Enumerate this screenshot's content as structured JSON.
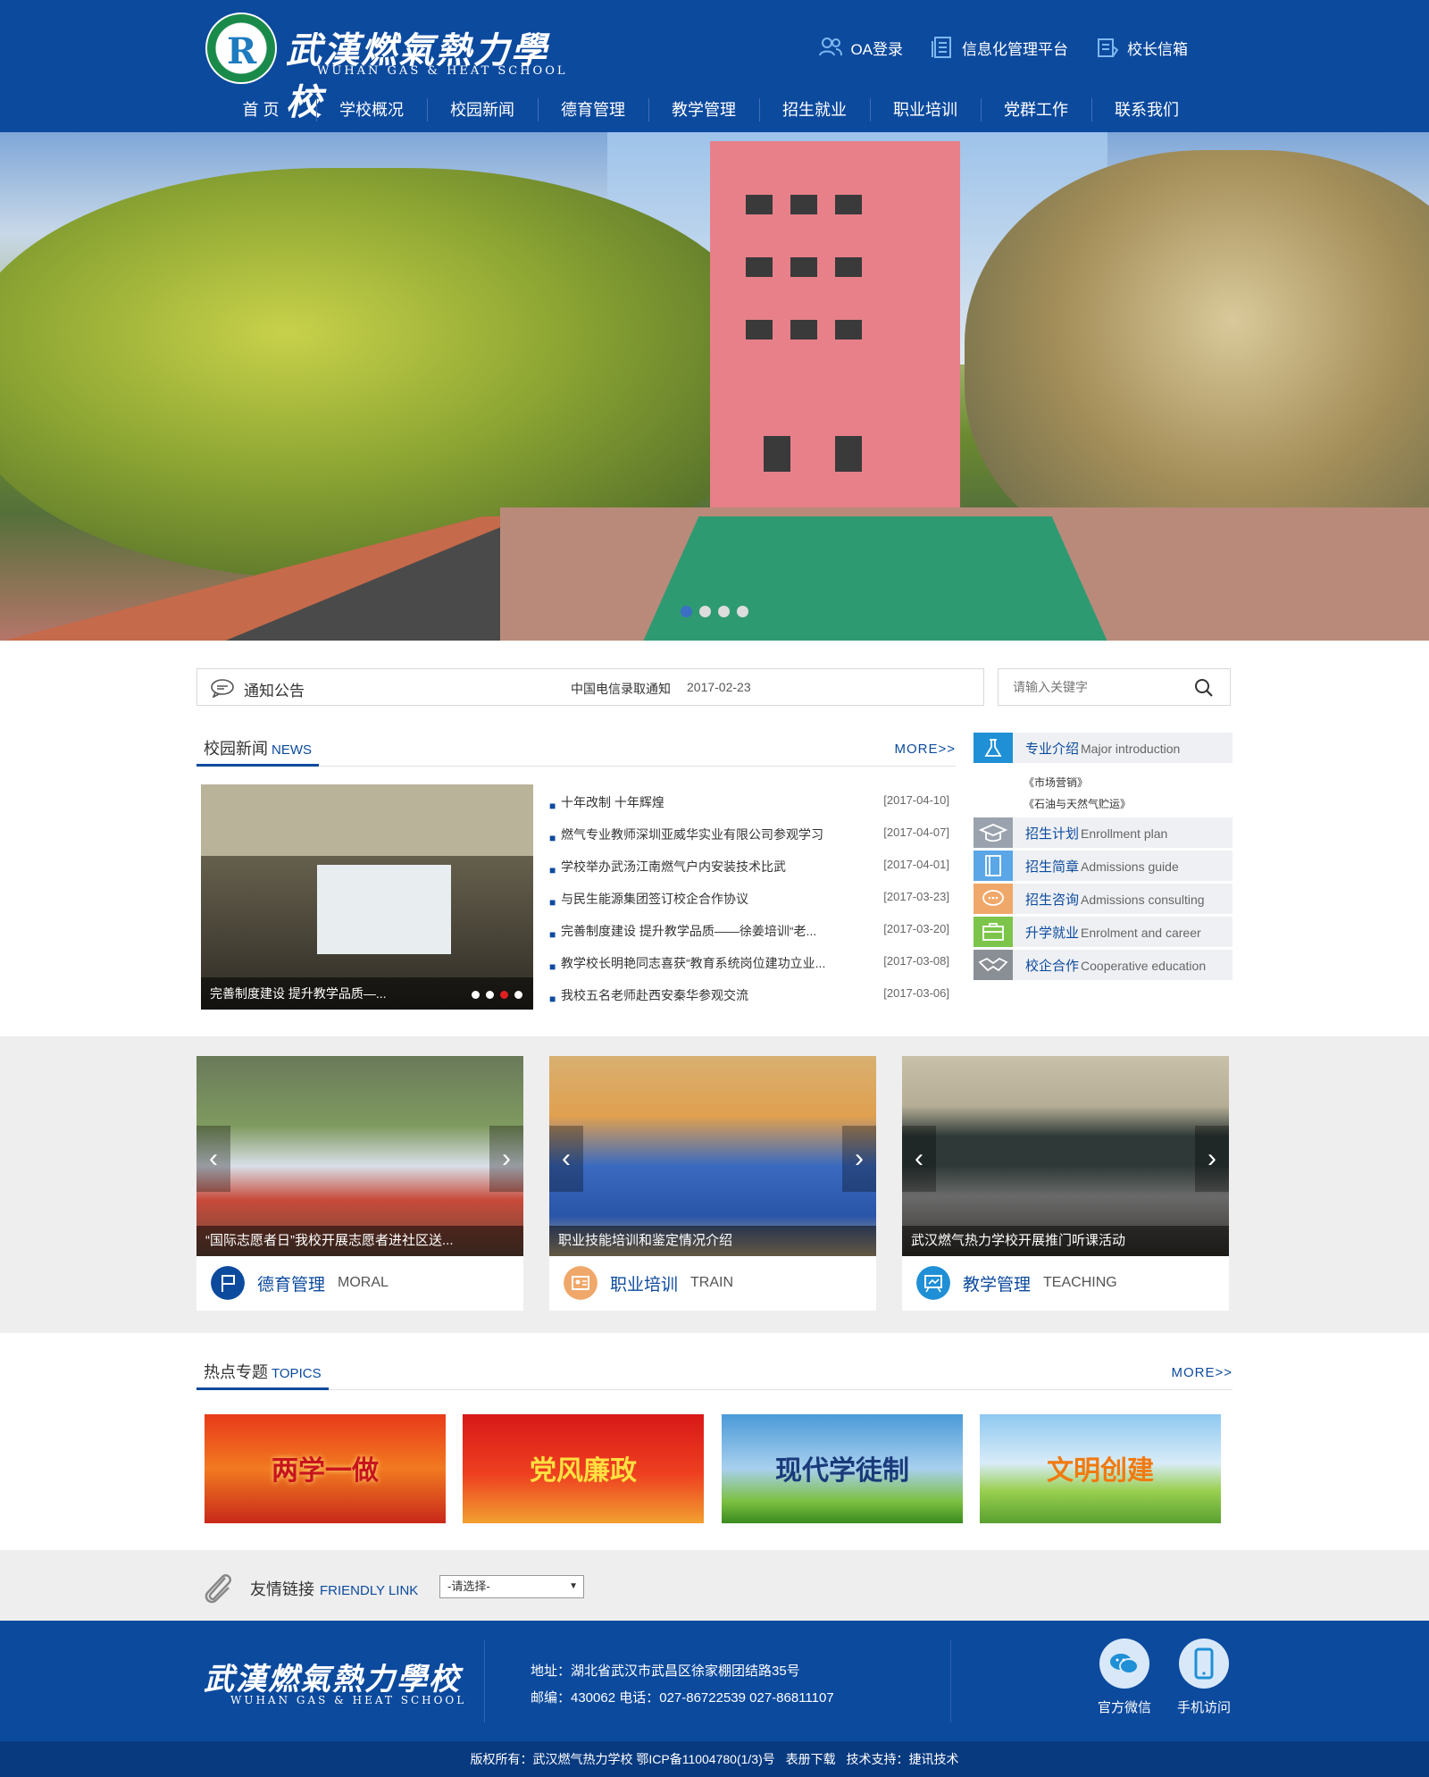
{
  "header": {
    "logo_cn": "武漢燃氣熱力學校",
    "logo_en": "WUHAN GAS & HEAT SCHOOL",
    "toplinks": [
      {
        "label": "OA登录",
        "icon": "users-icon"
      },
      {
        "label": "信息化管理平台",
        "icon": "document-icon"
      },
      {
        "label": "校长信箱",
        "icon": "mailbox-icon"
      }
    ],
    "nav": [
      "首 页",
      "学校概况",
      "校园新闻",
      "德育管理",
      "教学管理",
      "招生就业",
      "职业培训",
      "党群工作",
      "联系我们"
    ]
  },
  "banner": {
    "slides": 4,
    "active_slide": 1
  },
  "notice": {
    "title": "通知公告",
    "text": "中国电信录取通知",
    "date": "2017-02-23"
  },
  "search": {
    "placeholder": "请输入关键字"
  },
  "news": {
    "title_cn": "校园新闻",
    "title_en": "NEWS",
    "more": "MORE>>",
    "featured_caption": "完善制度建设 提升教学品质—...",
    "items": [
      {
        "title": "十年改制 十年辉煌",
        "date": "[2017-04-10]"
      },
      {
        "title": "燃气专业教师深圳亚威华实业有限公司参观学习",
        "date": "[2017-04-07]"
      },
      {
        "title": "学校举办武汤江南燃气户内安装技术比武",
        "date": "[2017-04-01]"
      },
      {
        "title": "与民生能源集团签订校企合作协议",
        "date": "[2017-03-23]"
      },
      {
        "title": "完善制度建设 提升教学品质——徐姜培训“老...",
        "date": "[2017-03-20]"
      },
      {
        "title": "教学校长明艳同志喜获“教育系统岗位建功立业...",
        "date": "[2017-03-08]"
      },
      {
        "title": "我校五名老师赴西安秦华参观交流",
        "date": "[2017-03-06]"
      }
    ]
  },
  "sidebar": {
    "major": {
      "cn": "专业介绍",
      "en": "Major introduction",
      "subs": [
        "《市场营销》",
        "《石油与天然气贮运》"
      ]
    },
    "items": [
      {
        "cn": "招生计划",
        "en": "Enrollment plan",
        "icon": "graduation-cap-icon",
        "color": "#9aa3ad"
      },
      {
        "cn": "招生简章",
        "en": "Admissions guide",
        "icon": "book-icon",
        "color": "#5aa6e6"
      },
      {
        "cn": "招生咨询",
        "en": "Admissions consulting",
        "icon": "chat-bubble-icon",
        "color": "#f0a86a"
      },
      {
        "cn": "升学就业",
        "en": "Enrolment and career",
        "icon": "briefcase-icon",
        "color": "#7cc54a"
      },
      {
        "cn": "校企合作",
        "en": "Cooperative education",
        "icon": "handshake-icon",
        "color": "#8a8f96"
      }
    ]
  },
  "cards": [
    {
      "caption": "“国际志愿者日”我校开展志愿者进社区送...",
      "cn": "德育管理",
      "en": "MORAL",
      "icon": "flag-icon",
      "color": "#0c4a9e"
    },
    {
      "caption": "职业技能培训和鉴定情况介绍",
      "cn": "职业培训",
      "en": "TRAIN",
      "icon": "person-card-icon",
      "color": "#f0a86a"
    },
    {
      "caption": "武汉燃气热力学校开展推门听课活动",
      "cn": "教学管理",
      "en": "TEACHING",
      "icon": "whiteboard-icon",
      "color": "#1f8fd6"
    }
  ],
  "topics": {
    "title_cn": "热点专题",
    "title_en": "TOPICS",
    "more": "MORE>>",
    "items": [
      "两学一做",
      "党风廉政",
      "现代学徒制",
      "文明创建"
    ]
  },
  "friendly_link": {
    "title_cn": "友情链接",
    "title_en": "FRIENDLY LINK",
    "select_value": "-请选择-"
  },
  "footer": {
    "logo_cn": "武漢燃氣熱力學校",
    "logo_en": "WUHAN GAS & HEAT SCHOOL",
    "address": "地址：湖北省武汉市武昌区徐家棚团结路35号",
    "contact": "邮编：430062  电话：027-86722539  027-86811107",
    "wechat_label": "官方微信",
    "mobile_label": "手机访问",
    "copyright": "版权所有：武汉燃气热力学校   鄂ICP备11004780(1/3)号",
    "download": "表册下载",
    "support": "技术支持：捷讯技术"
  },
  "colors": {
    "primary": "#0c4a9e",
    "accent_red": "#e02020",
    "band_gray": "#eeeeee"
  }
}
